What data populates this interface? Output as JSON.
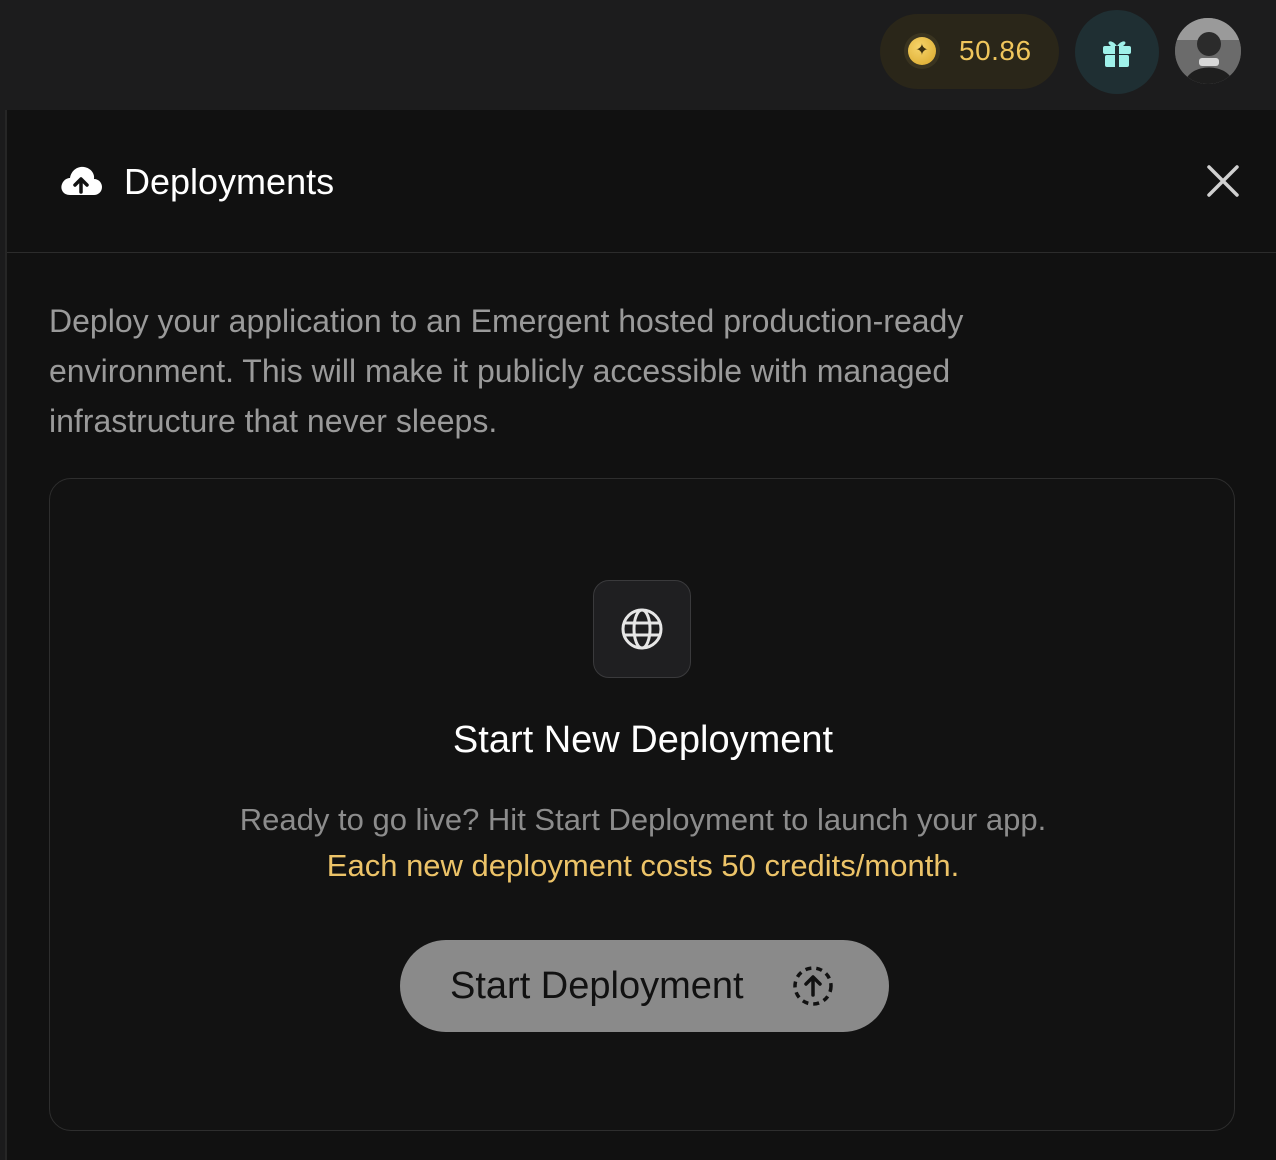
{
  "topbar": {
    "credits": {
      "value": "50.86",
      "icon": "coin-icon",
      "accent": "#f0c65c"
    },
    "gift_icon": "gift-icon",
    "avatar_icon": "user-avatar"
  },
  "panel": {
    "header": {
      "icon": "cloud-upload-icon",
      "title": "Deployments",
      "close_icon": "close-icon"
    },
    "description": "Deploy your application to an Emergent hosted production-ready environment. This will make it publicly accessible with managed infrastructure that never sleeps.",
    "card": {
      "icon": "globe-icon",
      "title": "Start New Deployment",
      "text": "Ready to go live? Hit Start Deployment to launch your app.",
      "cost_note": "Each new deployment costs 50 credits/month.",
      "cost_color": "#ecc368",
      "button": {
        "label": "Start Deployment",
        "icon": "deploy-upload-icon"
      }
    }
  }
}
